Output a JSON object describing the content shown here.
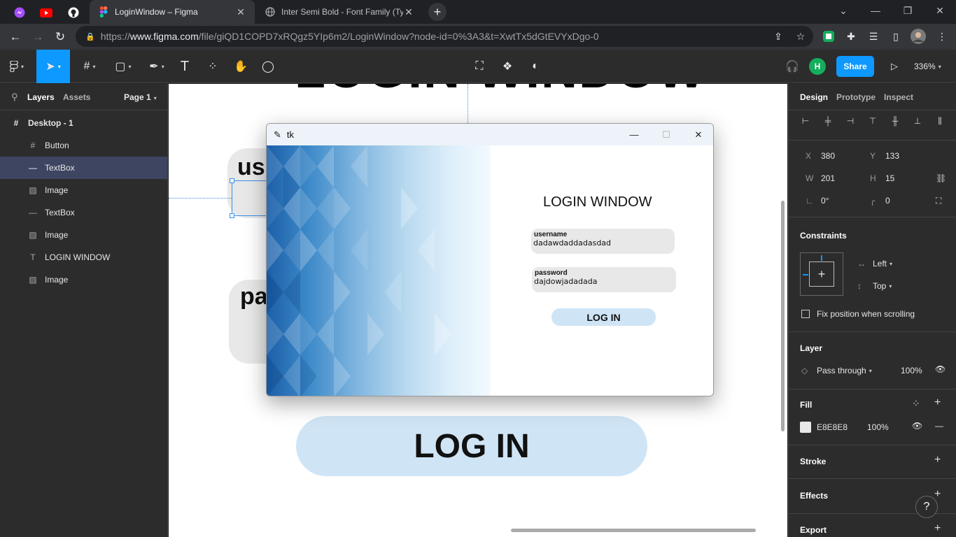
{
  "browser": {
    "tabs": [
      {
        "title": "LoginWindow – Figma",
        "active": true
      },
      {
        "title": "Inter Semi Bold - Font Family (Typ",
        "active": false
      }
    ],
    "url_prefix": "https://",
    "url_host": "www.figma.com",
    "url_path": "/file/giQD1COPD7xRQgz5YIp6m2/LoginWindow?node-id=0%3A3&t=XwtTx5dGtEVYxDgo-0"
  },
  "figma": {
    "share_label": "Share",
    "avatar_letter": "H",
    "zoom": "336%",
    "left_tabs": {
      "layers": "Layers",
      "assets": "Assets",
      "page": "Page 1"
    },
    "frame_name": "Desktop - 1",
    "layers": [
      {
        "name": "Button",
        "icon": "frame-icon"
      },
      {
        "name": "TextBox",
        "icon": "line-icon",
        "selected": true
      },
      {
        "name": "Image",
        "icon": "image-icon"
      },
      {
        "name": "TextBox",
        "icon": "line-icon"
      },
      {
        "name": "Image",
        "icon": "image-icon"
      },
      {
        "name": "LOGIN WINDOW",
        "icon": "text-icon"
      },
      {
        "name": "Image",
        "icon": "image-icon"
      }
    ],
    "canvas": {
      "big_title": "LOGIN WINDOW",
      "user_fragment": "use",
      "pass_fragment": "pa",
      "big_button": "LOG IN"
    },
    "right": {
      "tabs": {
        "design": "Design",
        "prototype": "Prototype",
        "inspect": "Inspect"
      },
      "x": "380",
      "y": "133",
      "w": "201",
      "h": "15",
      "rotation": "0°",
      "radius": "0",
      "constraints_title": "Constraints",
      "constraint_h": "Left",
      "constraint_v": "Top",
      "fix_position": "Fix position when scrolling",
      "layer_title": "Layer",
      "blend": "Pass through",
      "layer_opacity": "100%",
      "fill_title": "Fill",
      "fill_hex": "E8E8E8",
      "fill_opacity": "100%",
      "stroke_title": "Stroke",
      "effects_title": "Effects",
      "export_title": "Export"
    },
    "help": "?"
  },
  "tk": {
    "window_title": "tk",
    "heading": "LOGIN WINDOW",
    "username_label": "username",
    "username_value": "dadawdaddadasdad",
    "password_label": "password",
    "password_value": "dajdowjadadada",
    "login_button": "LOG IN"
  },
  "colors": {
    "figma_blue": "#0d99ff",
    "button_blue": "#cfe5f6",
    "field_gray": "#e8e8e8",
    "selection": "#3e4561"
  }
}
